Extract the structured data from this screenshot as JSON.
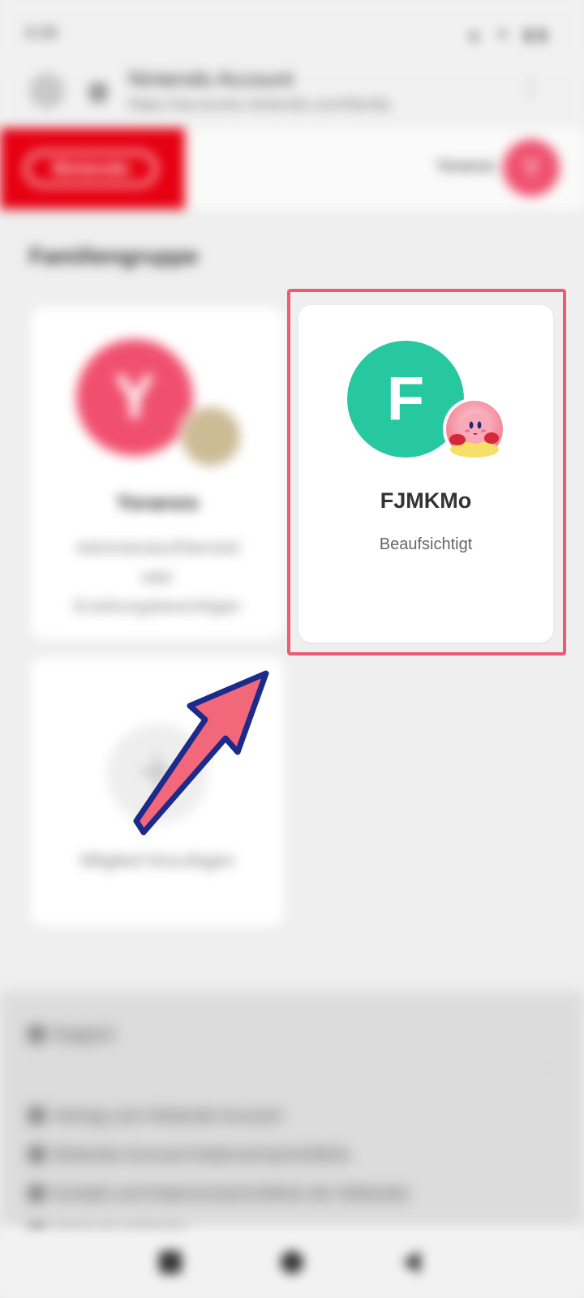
{
  "status_bar": {
    "time": "6:30",
    "icons": "▲ ✦ ▮▮"
  },
  "browser": {
    "title": "Nintendo Account",
    "address": "https://accounts.nintendo.com/family",
    "menu_icon": "⋮"
  },
  "header": {
    "brand": "Nintendo",
    "user_name": "Yoranos",
    "user_initial": "Y"
  },
  "page": {
    "section_title": "Familiengruppe"
  },
  "members": [
    {
      "initial": "Y",
      "name": "Yoranos",
      "role": "Administrator/Elternteil oder Erziehungsberechtigter",
      "color": "#f0506e"
    },
    {
      "initial": "F",
      "name": "FJMKMo",
      "role": "Beaufsichtigt",
      "color": "#27c8a0"
    }
  ],
  "add_member": {
    "icon": "+",
    "label": "Mitglied hinzufügen"
  },
  "footer": {
    "support": "Support",
    "links": [
      "Vertrag zum Nintendo Account",
      "Nintendo-Account-Datenschutzrichtlinie",
      "Kontakt und Datenschutzrichtlinie der Webseite",
      "Nintendo-Website"
    ]
  },
  "colors": {
    "highlight": "#ee5b70",
    "brand_red": "#e60012",
    "arrow_fill": "#f2677a",
    "arrow_stroke": "#1c2a8a"
  }
}
